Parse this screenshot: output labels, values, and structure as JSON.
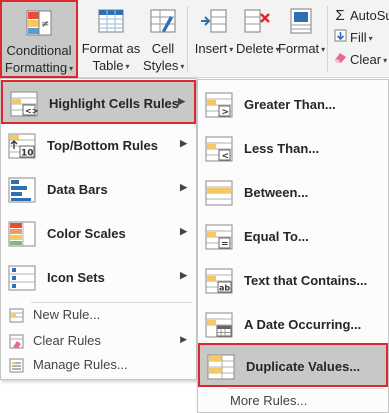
{
  "ribbon": {
    "conditional_formatting": {
      "line1": "Conditional",
      "line2": "Formatting"
    },
    "format_as_table": {
      "line1": "Format as",
      "line2": "Table"
    },
    "cell_styles": {
      "line1": "Cell",
      "line2": "Styles"
    },
    "insert": {
      "label": "Insert"
    },
    "delete": {
      "label": "Delete"
    },
    "format": {
      "label": "Format"
    },
    "autosum": {
      "symbol": "Σ",
      "label": "AutoSum"
    },
    "fill": {
      "label": "Fill"
    },
    "clear": {
      "label": "Clear"
    },
    "dropdown_caret": "▾"
  },
  "main_menu": {
    "items": [
      {
        "label": "Highlight Cells Rules",
        "icon": "highlight-cells-icon",
        "highlighted": true
      },
      {
        "label": "Top/Bottom Rules",
        "icon": "top-bottom-icon"
      },
      {
        "label": "Data Bars",
        "icon": "data-bars-icon"
      },
      {
        "label": "Color Scales",
        "icon": "color-scales-icon"
      },
      {
        "label": "Icon Sets",
        "icon": "icon-sets-icon"
      }
    ],
    "small_items": [
      {
        "label": "New Rule...",
        "icon": "new-rule-icon"
      },
      {
        "label": "Clear Rules",
        "icon": "clear-rules-icon"
      },
      {
        "label": "Manage Rules...",
        "icon": "manage-rules-icon"
      }
    ],
    "arrow": "▶"
  },
  "sub_menu": {
    "items": [
      {
        "label": "Greater Than...",
        "icon": "greater-than-icon"
      },
      {
        "label": "Less Than...",
        "icon": "less-than-icon"
      },
      {
        "label": "Between...",
        "icon": "between-icon"
      },
      {
        "label": "Equal To...",
        "icon": "equal-to-icon"
      },
      {
        "label": "Text that Contains...",
        "icon": "text-contains-icon"
      },
      {
        "label": "A Date Occurring...",
        "icon": "date-occurring-icon"
      },
      {
        "label": "Duplicate Values...",
        "icon": "duplicate-values-icon",
        "highlighted": true
      }
    ],
    "more_rules": "More Rules..."
  },
  "colors": {
    "highlight_border": "#e0262f",
    "highlight_bg": "#c8c8c8",
    "cell_yellow": "#f5c862",
    "icon_blue": "#2f6fb3"
  }
}
